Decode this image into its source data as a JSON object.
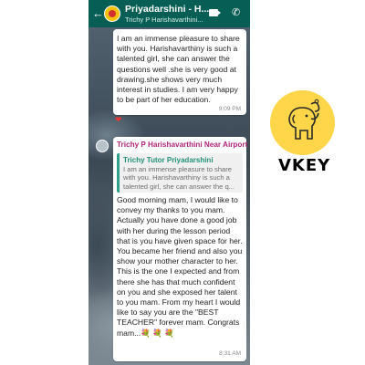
{
  "header": {
    "contact_name": "Priyadarshini - H...",
    "contact_sub": "Trichy P Harishavarthini..."
  },
  "messages": {
    "first": {
      "text": "I am an immense pleasure to share with you. Harishavarthiny is such a talented girl, she can answer the questions well .she is very good at drawing.she shows very much interest in studies. I am very happy to be part of her education.",
      "time": "9:09 PM",
      "reaction": "❤"
    },
    "second": {
      "sender": "Trichy P Harishavarthini Near Airport",
      "quote_name": "Trichy Tutor Priyadarshini",
      "quote_text": "I am an immense pleasure to share with you. Harishavarthiny is such a talented girl, she can answer the q...",
      "text": "Good morning mam, I would like to convey my thanks to you mam. Actually you have done a good job with her during the lesson period that is you have given space for her. You became her friend and also you show your mother character to her. This is the one I expected and from there she has that much confident on you and she exposed her talent to you mam. From my heart I would like to say you are the \"BEST TEACHER\" forever mam. Congrats mam...💐 💐 💐",
      "time": "8:31 AM"
    }
  },
  "brand": {
    "name": "VKEY",
    "logo_color": "#ffd54a"
  },
  "icons": {
    "back": "arrow-left-icon",
    "video": "video-call-icon",
    "call": "phone-icon"
  }
}
